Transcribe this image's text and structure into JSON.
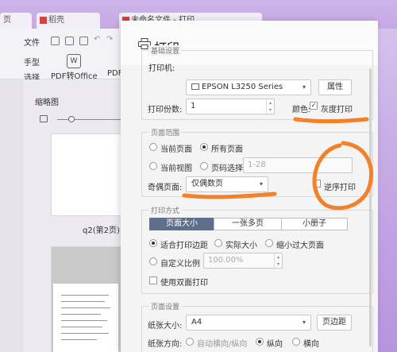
{
  "app": {
    "tabs": [
      "页",
      "稻壳",
      "未命名文件 - 打印"
    ],
    "menu": {
      "file": "文件",
      "hand_tool": "手型",
      "select_tool": "选择",
      "pdf_to_office": "PDF转Office",
      "pdf_short": "PDF"
    },
    "sidebar": {
      "title": "缩略图",
      "page2_label": "q2(第2页)"
    }
  },
  "dialog": {
    "title": "打印",
    "basic": {
      "legend": "基础设置",
      "printer_label": "打印机:",
      "printer_value": "EPSON L3250 Series",
      "properties_button": "属性",
      "copies_label": "打印份数:",
      "copies_value": "1",
      "color_label": "颜色:",
      "grayscale_label": "灰度打印",
      "grayscale_checked": true
    },
    "range": {
      "legend": "页面范围",
      "current_page": "当前页面",
      "all_pages": "所有页面",
      "current_view": "当前视图",
      "page_select": "页码选择:",
      "page_select_placeholder": "1-28",
      "odd_even_label": "奇偶页面:",
      "odd_even_value": "仅偶数页",
      "reverse_label": "逆序打印",
      "selected": "all_pages"
    },
    "mode": {
      "legend": "打印方式",
      "tabs": [
        "页面大小",
        "一张多页",
        "小册子"
      ],
      "active_tab": 0,
      "fit_margin": "适合打印边距",
      "actual_size": "实际大小",
      "shrink_large": "缩小过大页面",
      "custom_scale": "自定义比例",
      "scale_value": "100.00%",
      "duplex": "使用双面打印",
      "selected": "fit_margin"
    },
    "page_setup": {
      "legend": "页面设置",
      "paper_size_label": "纸张大小:",
      "paper_size_value": "A4",
      "margins_button": "页边距",
      "orientation_label": "纸张方向:",
      "auto_orientation": "自动横向/纵向",
      "portrait": "纵向",
      "landscape": "横向",
      "selected": "portrait"
    }
  },
  "colors": {
    "annotation": "#f2812a",
    "active_tab": "#5d6f8a"
  }
}
